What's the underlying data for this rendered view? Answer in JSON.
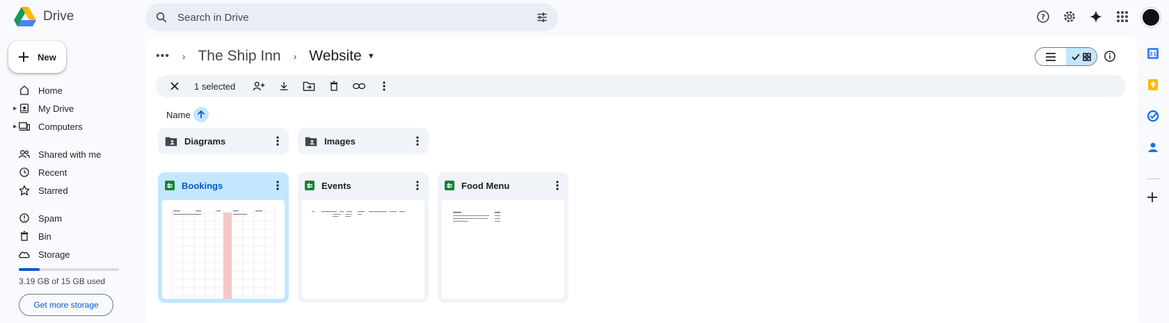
{
  "app": {
    "name": "Drive"
  },
  "search": {
    "placeholder": "Search in Drive"
  },
  "sidebar": {
    "new_label": "New",
    "items": [
      {
        "label": "Home",
        "icon": "home-icon"
      },
      {
        "label": "My Drive",
        "icon": "my-drive-icon"
      },
      {
        "label": "Computers",
        "icon": "computers-icon"
      },
      {
        "label": "Shared with me",
        "icon": "shared-icon"
      },
      {
        "label": "Recent",
        "icon": "clock-icon"
      },
      {
        "label": "Starred",
        "icon": "star-icon"
      },
      {
        "label": "Spam",
        "icon": "spam-icon"
      },
      {
        "label": "Bin",
        "icon": "bin-icon"
      },
      {
        "label": "Storage",
        "icon": "cloud-icon"
      }
    ],
    "storage_used_fraction": 0.21,
    "storage_text": "3.19 GB of 15 GB used",
    "storage_button": "Get more storage"
  },
  "breadcrumb": {
    "parent": "The Ship Inn",
    "current": "Website"
  },
  "selection": {
    "text": "1 selected"
  },
  "sort": {
    "label": "Name",
    "direction": "ascending"
  },
  "folders": [
    {
      "name": "Diagrams"
    },
    {
      "name": "Images"
    }
  ],
  "files": [
    {
      "name": "Bookings",
      "type": "spreadsheet",
      "selected": true
    },
    {
      "name": "Events",
      "type": "spreadsheet",
      "selected": false
    },
    {
      "name": "Food Menu",
      "type": "spreadsheet",
      "selected": false
    }
  ],
  "colors": {
    "accent": "#0b57d0",
    "selected_bg": "#c2e7ff",
    "sheets_green": "#188038",
    "chip_bg": "#f0f4f9"
  }
}
